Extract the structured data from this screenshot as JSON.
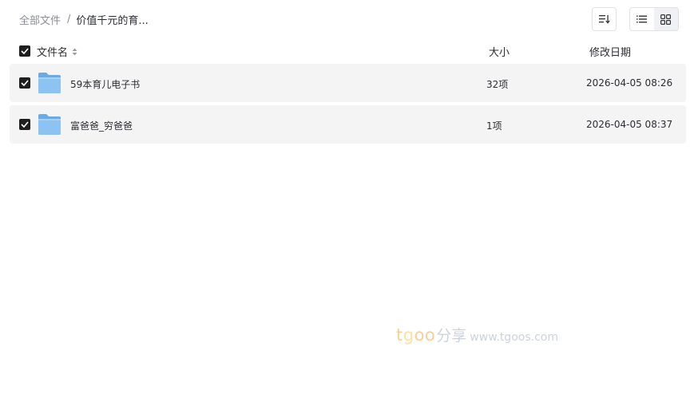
{
  "breadcrumb": {
    "root": "全部文件",
    "separator": "/",
    "current": "价值千元的育..."
  },
  "toolbar": {
    "sort_icon": "sort-icon",
    "list_view_icon": "list-view-icon",
    "grid_view_icon": "grid-view-icon"
  },
  "table": {
    "headers": {
      "name": "文件名",
      "size": "大小",
      "date": "修改日期"
    },
    "rows": [
      {
        "name": "59本育儿电子书",
        "size": "32项",
        "date": "2026-04-05 08:26",
        "icon": "folder-icon",
        "checked": true
      },
      {
        "name": "富爸爸_穷爸爸",
        "size": "1项",
        "date": "2026-04-05 08:37",
        "icon": "folder-icon",
        "checked": true
      }
    ]
  },
  "watermark": {
    "brand_t": "t",
    "brand_g": "g",
    "brand_oo": "oo",
    "cn": "分享",
    "url": "www.tgoos.com"
  },
  "colors": {
    "row_background": "#f4f4f5",
    "checkbox": "#1f1f1f",
    "folder": "#7fb8ec"
  }
}
